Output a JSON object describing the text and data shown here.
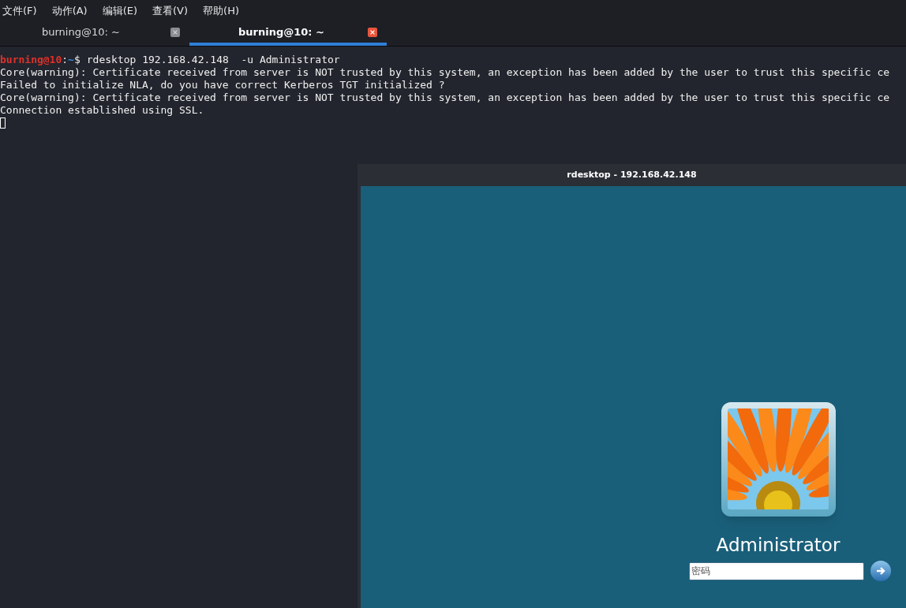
{
  "menu": [
    "文件(F)",
    "动作(A)",
    "编辑(E)",
    "查看(V)",
    "帮助(H)"
  ],
  "tabs": [
    {
      "label": "burning@10: ~",
      "selected": false
    },
    {
      "label": "burning@10: ~",
      "selected": true
    }
  ],
  "terminal": {
    "prompt": {
      "user_host": "burning@10",
      "separator": ":",
      "path": "~",
      "symbol": "$"
    },
    "command": "rdesktop 192.168.42.148  -u Administrator",
    "output": [
      "Core(warning): Certificate received from server is NOT trusted by this system, an exception has been added by the user to trust this specific ce",
      "Failed to initialize NLA, do you have correct Kerberos TGT initialized ?",
      "Core(warning): Certificate received from server is NOT trusted by this system, an exception has been added by the user to trust this specific ce",
      "Connection established using SSL."
    ]
  },
  "rdesktop": {
    "title": "rdesktop - 192.168.42.148",
    "login": {
      "username": "Administrator",
      "password": {
        "placeholder": "密码"
      }
    }
  }
}
